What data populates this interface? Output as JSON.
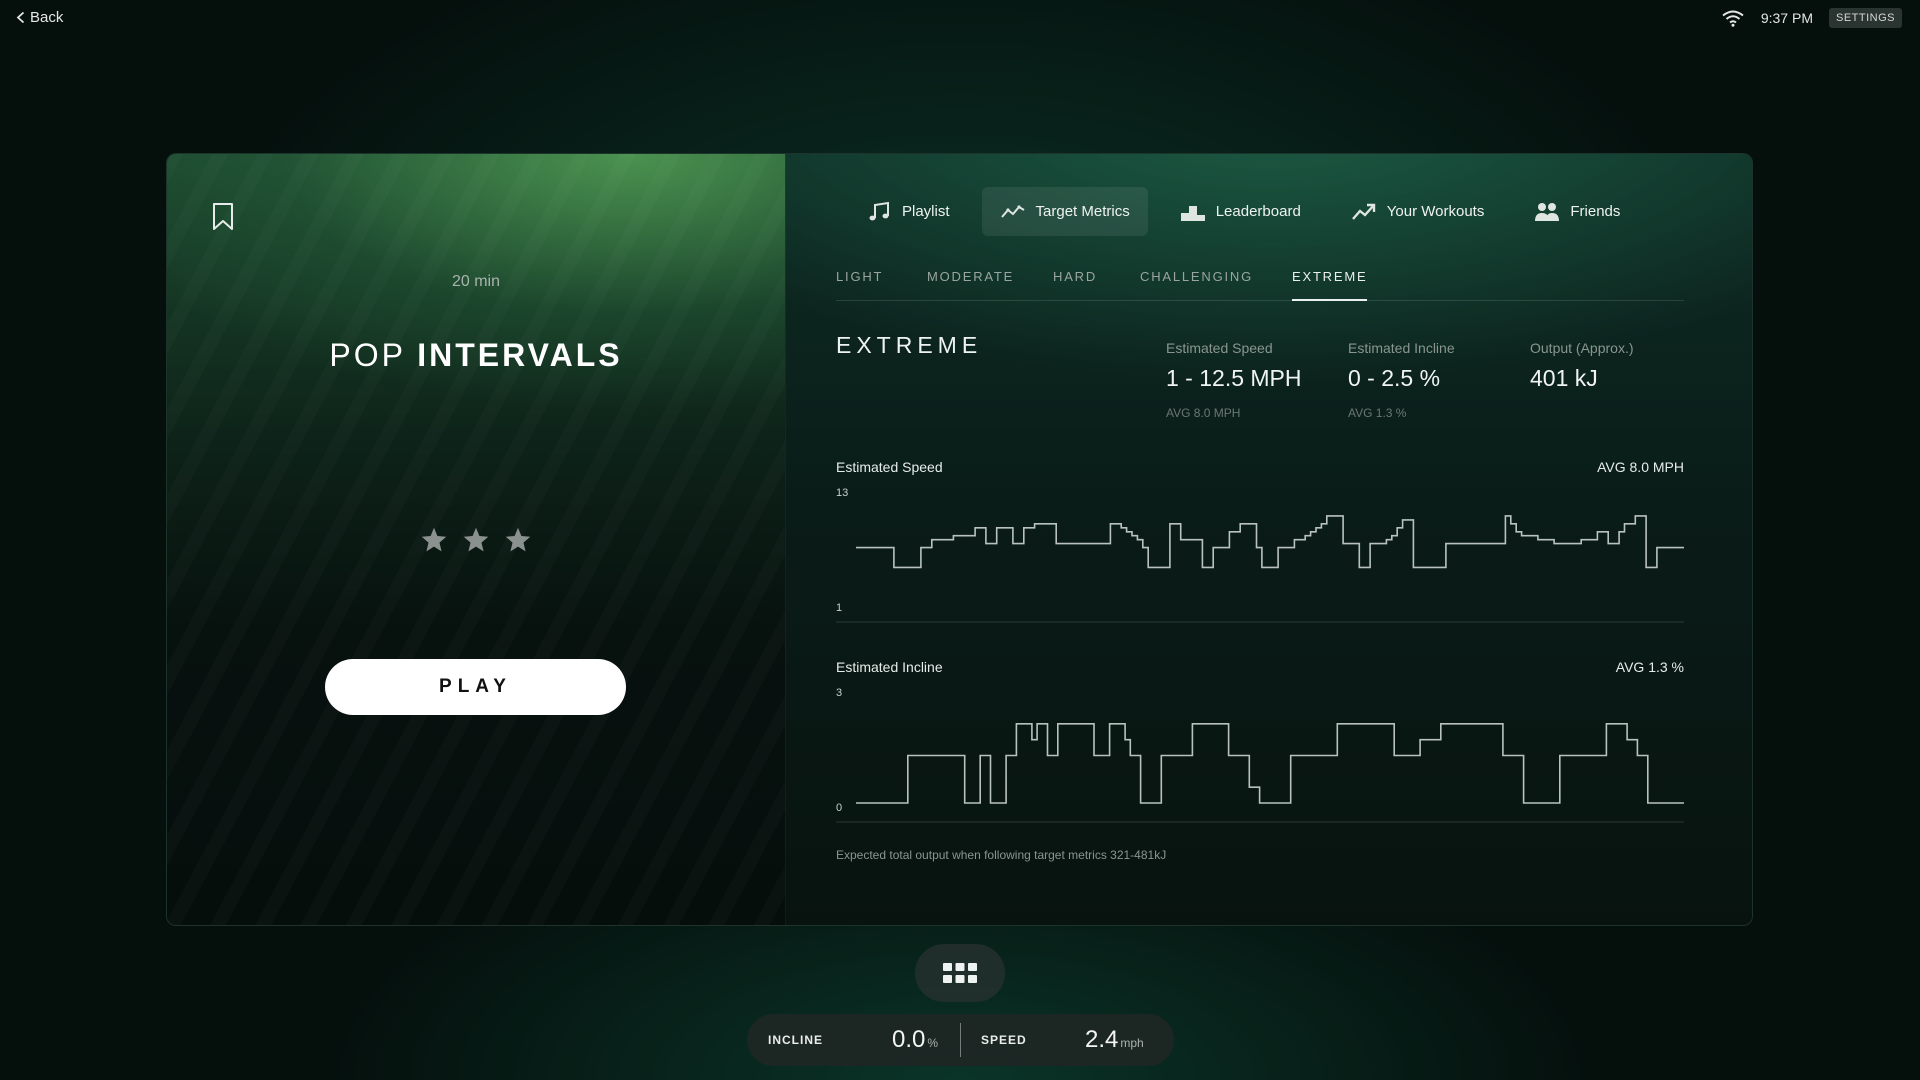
{
  "topbar": {
    "back_label": "Back",
    "time": "9:37 PM",
    "settings_label": "SETTINGS"
  },
  "workout": {
    "duration": "20 min",
    "title_light": "POP",
    "title_bold": "INTERVALS",
    "rating": 3,
    "play_label": "PLAY"
  },
  "tabs": [
    {
      "label": "Playlist",
      "icon": "music-note-icon"
    },
    {
      "label": "Target Metrics",
      "icon": "trend-line-icon",
      "active": true
    },
    {
      "label": "Leaderboard",
      "icon": "podium-icon"
    },
    {
      "label": "Your Workouts",
      "icon": "trending-up-icon"
    },
    {
      "label": "Friends",
      "icon": "friends-icon"
    }
  ],
  "levels": [
    {
      "label": "LIGHT"
    },
    {
      "label": "MODERATE"
    },
    {
      "label": "HARD"
    },
    {
      "label": "CHALLENGING"
    },
    {
      "label": "EXTREME",
      "active": true
    }
  ],
  "metrics": {
    "level_name": "EXTREME",
    "speed": {
      "label": "Estimated Speed",
      "value": "1 - 12.5 MPH",
      "avg": "AVG 8.0 MPH"
    },
    "incline": {
      "label": "Estimated Incline",
      "value": "0 - 2.5 %",
      "avg": "AVG 1.3 %"
    },
    "output": {
      "label": "Output (Approx.)",
      "value": "401 kJ"
    }
  },
  "speed_chart": {
    "title": "Estimated Speed",
    "avg": "AVG 8.0 MPH",
    "y_max_label": "13",
    "y_min_label": "1",
    "ylim": [
      1,
      13
    ],
    "values": [
      8,
      8,
      8,
      8,
      8,
      8,
      8,
      5.5,
      5.5,
      5.5,
      5.5,
      5.5,
      8,
      8,
      9,
      9,
      9,
      9,
      9.5,
      9.5,
      9.5,
      9.5,
      10.5,
      10.5,
      8.5,
      8.5,
      10.5,
      10.5,
      10.5,
      8.5,
      8.5,
      10.5,
      10.5,
      11,
      11,
      11,
      11,
      8.5,
      8.5,
      8.5,
      8.5,
      8.5,
      8.5,
      8.5,
      8.5,
      8.5,
      8.5,
      11,
      11,
      10.5,
      10,
      9.5,
      9,
      8,
      5.5,
      5.5,
      5.5,
      5.5,
      11,
      11,
      9,
      9,
      9,
      9,
      5.5,
      5.5,
      8,
      8,
      8,
      10,
      10,
      11,
      11,
      11,
      8,
      5.5,
      5.5,
      5.5,
      8,
      8,
      8,
      9,
      9,
      9.5,
      10,
      10.5,
      11,
      12,
      12,
      12,
      8.5,
      8.5,
      8.5,
      5.5,
      5.5,
      8.5,
      8.5,
      8.5,
      9,
      9.5,
      10.5,
      11.5,
      11.5,
      5.5,
      5.5,
      5.5,
      5.5,
      5.5,
      5.5,
      8.5,
      8.5,
      8.5,
      8.5,
      8.5,
      8.5,
      8.5,
      8.5,
      8.5,
      8.5,
      8.5,
      12,
      11,
      10,
      9.5,
      9.5,
      9.5,
      9,
      9,
      9,
      8.5,
      8.5,
      8.5,
      8.5,
      8.5,
      9,
      9,
      9,
      10,
      10,
      8.5,
      8.5,
      10,
      11,
      11,
      12,
      12,
      5.5,
      5.5,
      8,
      8,
      8,
      8,
      8
    ]
  },
  "incline_chart": {
    "title": "Estimated Incline",
    "avg": "AVG 1.3 %",
    "y_max_label": "3",
    "y_min_label": "0",
    "ylim": [
      0,
      3
    ],
    "values": [
      0,
      0,
      0,
      0,
      0,
      0,
      0,
      0,
      0,
      0,
      1.5,
      1.5,
      1.5,
      1.5,
      1.5,
      1.5,
      1.5,
      1.5,
      1.5,
      1.5,
      1.5,
      0,
      0,
      0,
      1.5,
      1.5,
      0,
      0,
      0,
      1.5,
      1.5,
      2.5,
      2.5,
      2.5,
      2,
      2.5,
      2.5,
      1.5,
      1.5,
      2.5,
      2.5,
      2.5,
      2.5,
      2.5,
      2.5,
      2.5,
      1.5,
      1.5,
      1.5,
      2.5,
      2.5,
      2.5,
      2,
      1.5,
      1.5,
      0,
      0,
      0,
      0,
      1.5,
      1.5,
      1.5,
      1.5,
      1.5,
      1.5,
      2.5,
      2.5,
      2.5,
      2.5,
      2.5,
      2.5,
      2.5,
      1.5,
      1.5,
      1.5,
      1.5,
      0.5,
      0.5,
      0,
      0,
      0,
      0,
      0,
      0,
      1.5,
      1.5,
      1.5,
      1.5,
      1.5,
      1.5,
      1.5,
      1.5,
      1.5,
      2.5,
      2.5,
      2.5,
      2.5,
      2.5,
      2.5,
      2.5,
      2.5,
      2.5,
      2.5,
      2.5,
      1.5,
      1.5,
      1.5,
      1.5,
      1.5,
      2,
      2,
      2,
      2,
      2.5,
      2.5,
      2.5,
      2.5,
      2.5,
      2.5,
      2.5,
      2.5,
      2.5,
      2.5,
      2.5,
      2.5,
      1.5,
      1.5,
      1.5,
      1.5,
      0,
      0,
      0,
      0,
      0,
      0,
      0,
      1.5,
      1.5,
      1.5,
      1.5,
      1.5,
      1.5,
      1.5,
      1.5,
      1.5,
      2.5,
      2.5,
      2.5,
      2.5,
      2,
      2,
      1.5,
      1.5,
      0,
      0,
      0,
      0,
      0,
      0,
      0
    ]
  },
  "footnote": "Expected total output when following target metrics 321-481kJ",
  "console": {
    "incline_label": "INCLINE",
    "incline_value": "0.0",
    "incline_unit": "%",
    "speed_label": "SPEED",
    "speed_value": "2.4",
    "speed_unit": "mph"
  }
}
